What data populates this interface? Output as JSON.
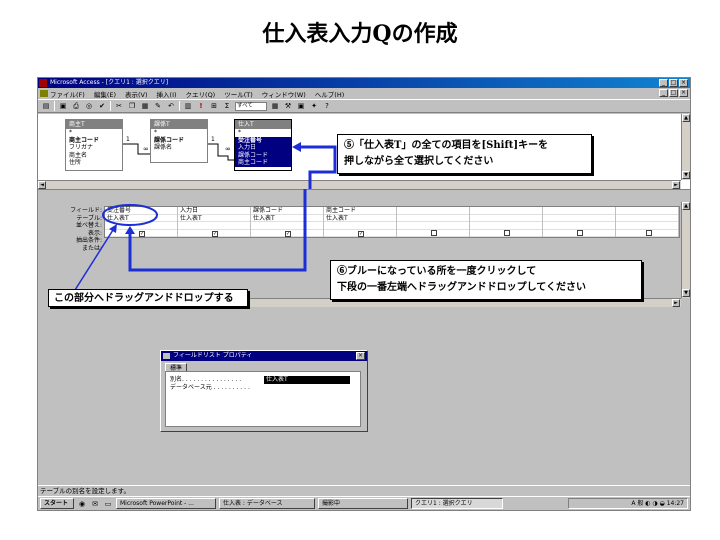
{
  "slide": {
    "title": "仕入表入力Qの作成"
  },
  "window": {
    "title": "Microsoft Access - [クエリ1 : 選択クエリ]",
    "menu": [
      "ファイル(F)",
      "編集(E)",
      "表示(V)",
      "挿入(I)",
      "クエリ(Q)",
      "ツール(T)",
      "ウィンドウ(W)",
      "ヘルプ(H)"
    ],
    "toolbar_combo": "すべて",
    "toolbar_sigma": "Σ"
  },
  "field_lists": [
    {
      "name": "商主T",
      "items": [
        {
          "text": "*",
          "bold": false
        },
        {
          "text": "商主コード",
          "bold": true
        },
        {
          "text": "フリガナ",
          "bold": false
        },
        {
          "text": "商主名",
          "bold": false
        },
        {
          "text": "住所",
          "bold": false
        }
      ]
    },
    {
      "name": "課係T",
      "items": [
        {
          "text": "*",
          "bold": false
        },
        {
          "text": "課係コード",
          "bold": true
        },
        {
          "text": "課係名",
          "bold": false
        }
      ]
    },
    {
      "name": "仕入T",
      "items": [
        {
          "text": "*",
          "bold": false
        },
        {
          "text": "受注番号",
          "bold": true
        },
        {
          "text": "入力日",
          "bold": false
        },
        {
          "text": "課係コード",
          "bold": false
        },
        {
          "text": "商主コード",
          "bold": false
        }
      ]
    }
  ],
  "relationships": [
    "1",
    "∞",
    "1",
    "∞"
  ],
  "grid": {
    "row_labels": [
      "フィールド:",
      "テーブル:",
      "並べ替え:",
      "表示:",
      "抽出条件:",
      "または:"
    ],
    "columns": [
      {
        "field": "受注番号",
        "table": "仕入表T",
        "show": true
      },
      {
        "field": "入力日",
        "table": "仕入表T",
        "show": true
      },
      {
        "field": "課係コード",
        "table": "仕入表T",
        "show": true
      },
      {
        "field": "商主コード",
        "table": "仕入表T",
        "show": true
      },
      {
        "field": "",
        "table": "",
        "show": false
      },
      {
        "field": "",
        "table": "",
        "show": false
      },
      {
        "field": "",
        "table": "",
        "show": false
      },
      {
        "field": "",
        "table": "",
        "show": false
      }
    ],
    "check_mark": "✓"
  },
  "properties": {
    "title": "フィールドリスト プロパティ",
    "tab": "標準",
    "rows": [
      {
        "label": "別名. . . . . . . . . . . . . . . .",
        "value": "仕入表T"
      },
      {
        "label": "データベース元 . . . . . . . . . .",
        "value": ""
      }
    ]
  },
  "status_bar": "テーブルの別名を設定します。",
  "taskbar": {
    "start": "スタート",
    "items": [
      "Microsoft PowerPoint - ...",
      "仕入表 : データベース",
      "撮影中",
      "クエリ1 : 選択クエリ"
    ],
    "tray_text": "A 般",
    "clock": "14:27"
  },
  "callouts": {
    "c5_line1": "⑤「仕入表T」の全ての項目を[Shift]キーを",
    "c5_line2": "押しながら全て選択してください",
    "c6_line1": "⑥ブルーになっている所を一度クリックして",
    "c6_line2": "下段の一番左端へドラッグアンドドロップしてください",
    "c7": "この部分へドラッグアンドドロップする"
  },
  "colors": {
    "annotation_blue": "#1c2fd6",
    "selection": "#000080",
    "title_bar": "#000080"
  }
}
